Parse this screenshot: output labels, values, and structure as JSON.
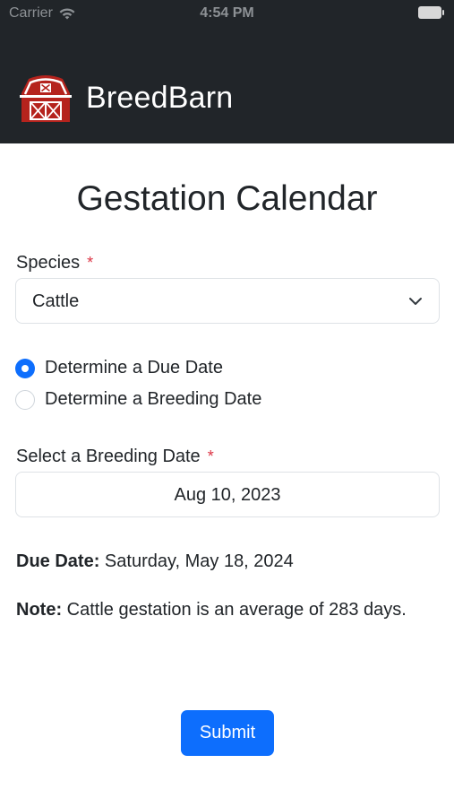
{
  "status_bar": {
    "carrier": "Carrier",
    "time": "4:54 PM"
  },
  "header": {
    "app_name": "BreedBarn",
    "logo_color": "#b5231d"
  },
  "form": {
    "title": "Gestation Calendar",
    "species_label": "Species",
    "required_mark": "*",
    "species_value": "Cattle",
    "radio_options": [
      {
        "label": "Determine a Due Date",
        "checked": true
      },
      {
        "label": "Determine a Breeding Date",
        "checked": false
      }
    ],
    "breeding_date_label": "Select a Breeding Date",
    "breeding_date_value": "Aug 10, 2023",
    "due_date_label": "Due Date:",
    "due_date_value": "Saturday, May 18, 2024",
    "note_label": "Note:",
    "note_text": "Cattle gestation is an average of 283 days.",
    "submit_label": "Submit"
  },
  "colors": {
    "header_bg": "#212529",
    "accent": "#0d6efd",
    "required": "#dc3545"
  }
}
